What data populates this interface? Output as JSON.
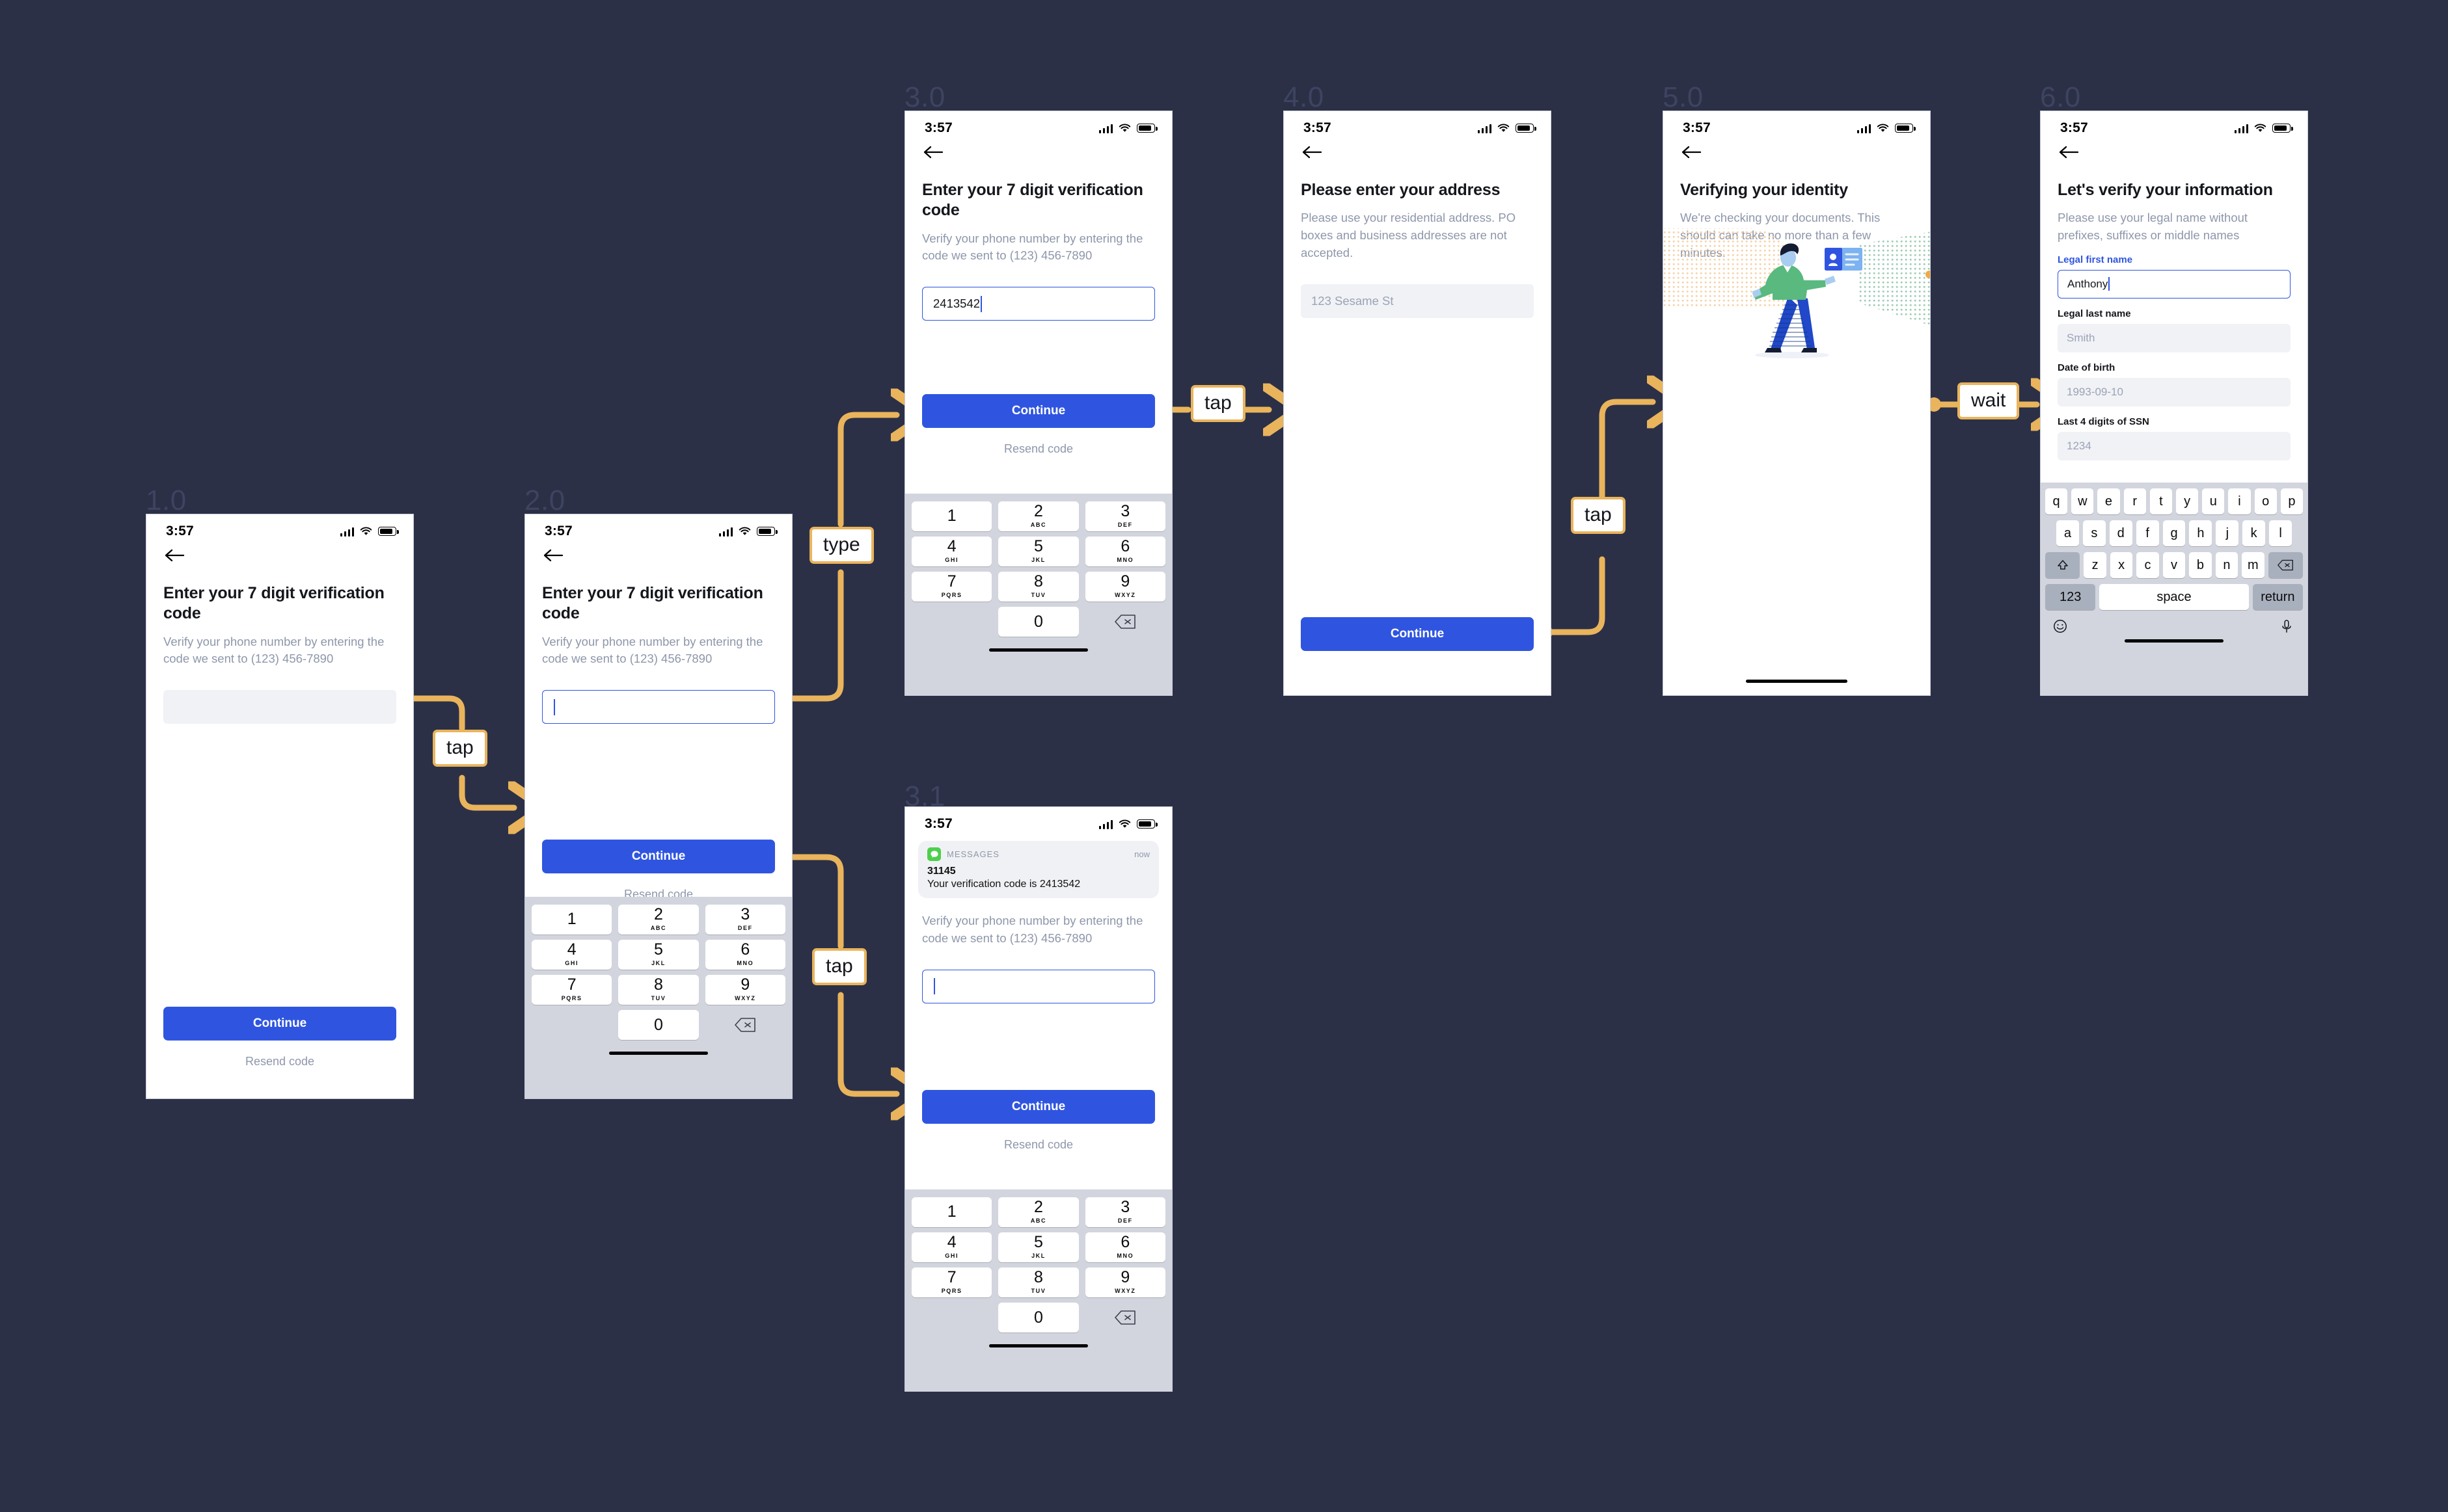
{
  "canvas": {
    "background": "#2b3047",
    "accent": "#e9b45c",
    "primary": "#2f55e0"
  },
  "status_bar": {
    "time": "3:57"
  },
  "screens": {
    "s1": {
      "flow_id": "1.0",
      "title": "Enter your 7 digit verification code",
      "subtitle": "Verify your phone number by entering the code we sent to (123) 456-7890",
      "input_value": "",
      "continue_label": "Continue",
      "resend_label": "Resend code"
    },
    "s2": {
      "flow_id": "2.0",
      "title": "Enter your 7 digit verification code",
      "subtitle": "Verify your phone number by entering the code we sent to (123) 456-7890",
      "input_value": "",
      "continue_label": "Continue",
      "resend_label": "Resend code"
    },
    "s3": {
      "flow_id": "3.0",
      "title": "Enter your 7 digit verification code",
      "subtitle": "Verify your phone number by entering the code we sent to (123) 456-7890",
      "input_value": "2413542",
      "continue_label": "Continue",
      "resend_label": "Resend code"
    },
    "s31": {
      "flow_id": "3.1",
      "notification": {
        "app": "MESSAGES",
        "time": "now",
        "sender": "31145",
        "body": "Your verification code is 2413542"
      },
      "subtitle": "Verify your phone number by entering the code we sent to (123) 456-7890",
      "input_value": "",
      "continue_label": "Continue",
      "resend_label": "Resend code"
    },
    "s4": {
      "flow_id": "4.0",
      "title": "Please enter your address",
      "subtitle": "Please use your residential address. PO boxes and business addresses are not accepted.",
      "address_placeholder": "123 Sesame St",
      "continue_label": "Continue"
    },
    "s5": {
      "flow_id": "5.0",
      "title": "Verifying your identity",
      "subtitle": "We're checking your documents. This should can take no more than a few minutes."
    },
    "s6": {
      "flow_id": "6.0",
      "title": "Let's verify your information",
      "subtitle": "Please use your legal name without prefixes, suffixes or middle names",
      "fields": [
        {
          "label": "Legal first name",
          "value": "Anthony",
          "state": "focused"
        },
        {
          "label": "Legal last name",
          "value": "Smith",
          "state": "placeholder"
        },
        {
          "label": "Date of birth",
          "value": "1993-09-10",
          "state": "placeholder"
        },
        {
          "label": "Last 4 digits of SSN",
          "value": "1234",
          "state": "placeholder"
        }
      ]
    }
  },
  "keypad": {
    "keys": [
      {
        "num": "1",
        "sub": ""
      },
      {
        "num": "2",
        "sub": "ABC"
      },
      {
        "num": "3",
        "sub": "DEF"
      },
      {
        "num": "4",
        "sub": "GHI"
      },
      {
        "num": "5",
        "sub": "JKL"
      },
      {
        "num": "6",
        "sub": "MNO"
      },
      {
        "num": "7",
        "sub": "PQRS"
      },
      {
        "num": "8",
        "sub": "TUV"
      },
      {
        "num": "9",
        "sub": "WXYZ"
      },
      {
        "num": "0",
        "sub": ""
      }
    ]
  },
  "qwerty": {
    "row1": [
      "q",
      "w",
      "e",
      "r",
      "t",
      "y",
      "u",
      "i",
      "o",
      "p"
    ],
    "row2": [
      "a",
      "s",
      "d",
      "f",
      "g",
      "h",
      "j",
      "k",
      "l"
    ],
    "row3": [
      "z",
      "x",
      "c",
      "v",
      "b",
      "n",
      "m"
    ],
    "numbers_label": "123",
    "space_label": "space",
    "return_label": "return"
  },
  "actions": [
    {
      "id": "a1",
      "label": "tap"
    },
    {
      "id": "a2",
      "label": "type"
    },
    {
      "id": "a3",
      "label": "tap"
    },
    {
      "id": "a4",
      "label": "tap"
    },
    {
      "id": "a5",
      "label": "tap"
    },
    {
      "id": "a6",
      "label": "wait"
    }
  ]
}
